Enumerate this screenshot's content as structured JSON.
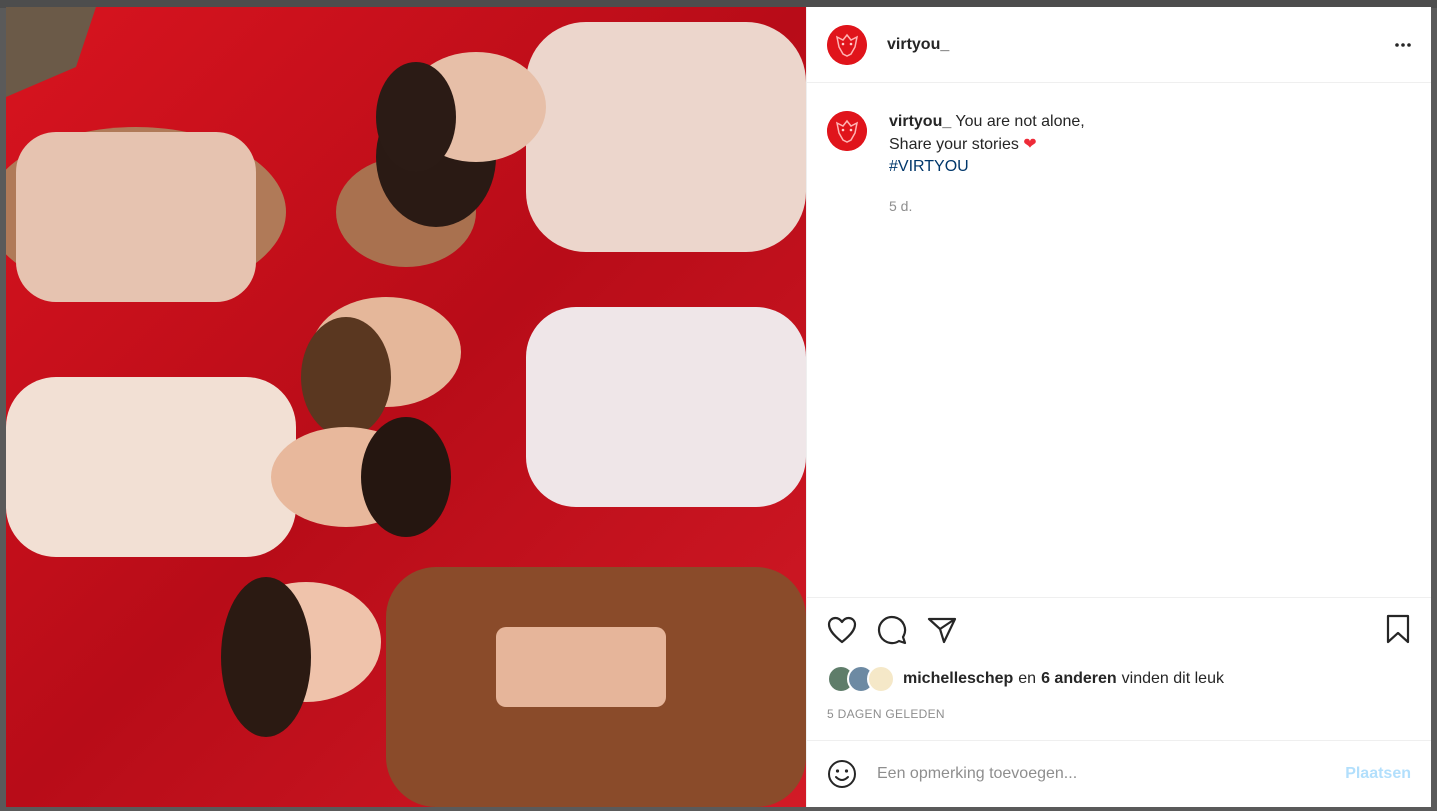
{
  "post": {
    "username": "virtyou_",
    "caption_line1": "You are not alone,",
    "caption_line2": "Share your stories",
    "caption_heart": "❤",
    "hashtag": "#VIRTYOU",
    "time_ago": "5 d.",
    "more_label": "•••"
  },
  "likes": {
    "user": "michelleschep",
    "connector": "en",
    "others": "6 anderen",
    "suffix": "vinden dit leuk"
  },
  "date_label": "5 DAGEN GELEDEN",
  "comment": {
    "placeholder": "Een opmerking toevoegen...",
    "post_label": "Plaatsen"
  },
  "colors": {
    "brand_red": "#e0141b",
    "hashtag": "#00376b",
    "muted": "#8e8e8e",
    "post_button_disabled": "#b2dffc"
  },
  "icons": {
    "like": "heart-outline-icon",
    "comment": "comment-bubble-icon",
    "share": "paper-plane-icon",
    "save": "bookmark-icon",
    "emoji": "smiley-icon",
    "more": "ellipsis-icon"
  }
}
